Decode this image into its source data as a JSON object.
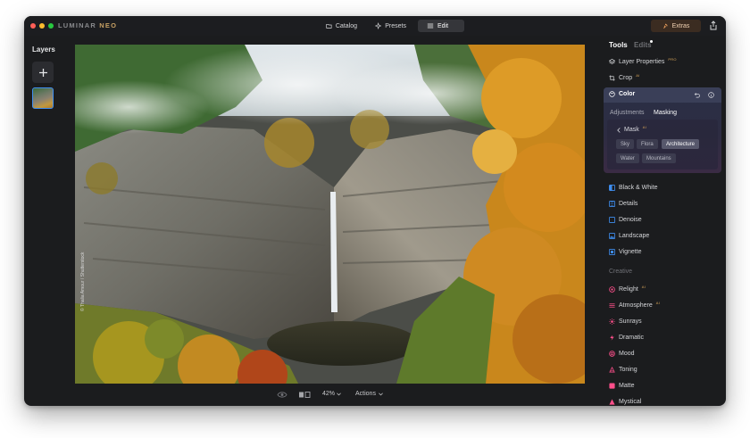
{
  "app": {
    "logo_main": "LUMINAR",
    "logo_accent": "NEO"
  },
  "modes": [
    {
      "label": "Catalog",
      "icon": "folder-icon"
    },
    {
      "label": "Presets",
      "icon": "presets-icon"
    },
    {
      "label": "Edit",
      "icon": "sliders-icon",
      "active": true
    }
  ],
  "extras_label": "Extras",
  "layers": {
    "title": "Layers"
  },
  "photo": {
    "credit": "© Thalia Amour / Shutterstock"
  },
  "bottom": {
    "zoom": "42%",
    "actions": "Actions"
  },
  "tabs": {
    "tools": "Tools",
    "edits": "Edits"
  },
  "tools_top": [
    {
      "label": "Layer Properties",
      "badge": "PRO",
      "icon": "layers-icon"
    },
    {
      "label": "Crop",
      "badge": "AI",
      "icon": "crop-icon"
    }
  ],
  "color_panel": {
    "title": "Color",
    "tabs": [
      "Adjustments",
      "Masking"
    ],
    "active_tab": "Masking",
    "mask": {
      "title": "Mask",
      "badge": "AI",
      "chips": [
        "Sky",
        "Flora",
        "Architecture",
        "Water",
        "Mountains"
      ],
      "selected": "Architecture"
    }
  },
  "essentials": [
    {
      "label": "Black & White",
      "icon": "bw-icon",
      "color": "#3f8ef0"
    },
    {
      "label": "Details",
      "icon": "details-icon",
      "color": "#3f8ef0"
    },
    {
      "label": "Denoise",
      "icon": "denoise-icon",
      "color": "#3f8ef0"
    },
    {
      "label": "Landscape",
      "icon": "landscape-icon",
      "color": "#3f8ef0"
    },
    {
      "label": "Vignette",
      "icon": "vignette-icon",
      "color": "#3f8ef0"
    }
  ],
  "creative": {
    "title": "Creative",
    "items": [
      {
        "label": "Relight",
        "badge": "AI",
        "icon": "relight-icon",
        "color": "#ff4f8b"
      },
      {
        "label": "Atmosphere",
        "badge": "AI",
        "icon": "atmosphere-icon",
        "color": "#ff4f8b"
      },
      {
        "label": "Sunrays",
        "badge": "",
        "icon": "sunrays-icon",
        "color": "#ff4f8b"
      },
      {
        "label": "Dramatic",
        "badge": "",
        "icon": "dramatic-icon",
        "color": "#ff4f8b"
      },
      {
        "label": "Mood",
        "badge": "",
        "icon": "mood-icon",
        "color": "#ff4f8b"
      },
      {
        "label": "Toning",
        "badge": "",
        "icon": "toning-icon",
        "color": "#ff4f8b"
      },
      {
        "label": "Matte",
        "badge": "",
        "icon": "matte-icon",
        "color": "#ff4f8b"
      },
      {
        "label": "Mystical",
        "badge": "",
        "icon": "mystical-icon",
        "color": "#ff4f8b"
      }
    ]
  }
}
